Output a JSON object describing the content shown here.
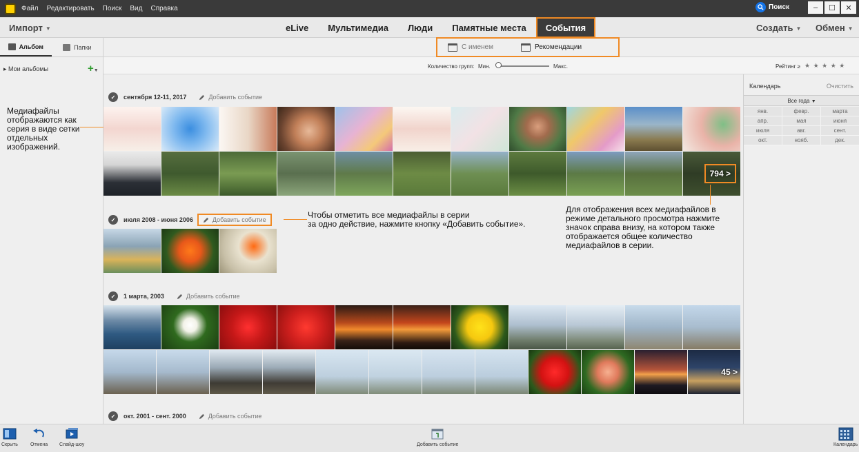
{
  "menu": [
    "Файл",
    "Редактировать",
    "Поиск",
    "Вид",
    "Справка"
  ],
  "search_label": "Поиск",
  "window_controls": [
    "–",
    "☐",
    "✕"
  ],
  "toolbar": {
    "import_label": "Импорт",
    "create_label": "Создать",
    "share_label": "Обмен"
  },
  "nav_tabs": [
    "eLive",
    "Мультимедиа",
    "Люди",
    "Памятные места",
    "События"
  ],
  "active_tab": "События",
  "sidebar": {
    "tab_album": "Альбом",
    "tab_folders": "Папки",
    "my_albums": "Мои альбомы"
  },
  "subtabs": {
    "named": "С именем",
    "suggested": "Рекомендации"
  },
  "group_slider": {
    "label": "Количество групп:",
    "min": "Мин.",
    "max": "Макс."
  },
  "rating": {
    "label": "Рейтинг",
    "symbol": "≥",
    "stars": "★ ★ ★ ★ ★"
  },
  "events": [
    {
      "date": "сентября 12-11, 2017",
      "add": "Добавить событие",
      "count": "794 >"
    },
    {
      "date": "июля 2008 - июня 2006",
      "add": "Добавить событие"
    },
    {
      "date": "1 марта, 2003",
      "add": "Добавить событие",
      "count": "45 >"
    },
    {
      "date": "окт. 2001 - сент. 2000",
      "add": "Добавить событие"
    }
  ],
  "calendar": {
    "title": "Календарь",
    "clear": "Очистить",
    "years": "Все года",
    "months": [
      "янв.",
      "февр.",
      "марта",
      "апр.",
      "мая",
      "июня",
      "июля",
      "авг.",
      "сент.",
      "окт.",
      "нояб.",
      "дек."
    ]
  },
  "annotations": {
    "left": "Медиафайлы отображаются как серия в виде сетки отдельных изображений.",
    "middle_1": "Чтобы отметить все медиафайлы в серии",
    "middle_2": "за одно действие, нажмите кнопку «Добавить событие».",
    "right": "Для отображения всех медиафайлов в режиме детального просмотра нажмите значок справа внизу, на котором также отображается общее количество медиафайлов в серии."
  },
  "bottom_bar": {
    "hide": "Скрыть",
    "undo": "Отмена",
    "slideshow": "Слайд-шоу",
    "add_event": "Добавить событие",
    "calendar": "Календарь"
  },
  "colors": {
    "accent": "#f08a24",
    "active_tab_bg": "#3b3b3b",
    "search_blue": "#1473e6"
  }
}
